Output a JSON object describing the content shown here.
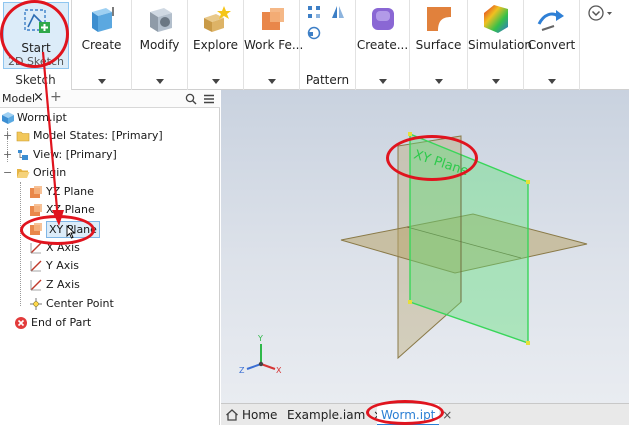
{
  "ribbon": {
    "sketch": {
      "start_label": "Start",
      "sketch2d_label": "2D Sketch",
      "group_title": "Sketch"
    },
    "buttons": {
      "create": "Create",
      "modify": "Modify",
      "explore": "Explore",
      "work_features": "Work Fe...",
      "pattern": "Pattern",
      "create_freeform": "Create...",
      "surface": "Surface",
      "simulation": "Simulation",
      "convert": "Convert"
    }
  },
  "browser": {
    "tab_label": "Model",
    "tab_close": "×",
    "tab_add": "+",
    "root": "Worm.ipt",
    "items": {
      "model_states": "Model States: [Primary]",
      "view": "View: [Primary]",
      "origin": "Origin",
      "yz_plane": "YZ Plane",
      "xz_plane": "XZ Plane",
      "xy_plane": "XY Plane",
      "x_axis": "X Axis",
      "y_axis": "Y Axis",
      "z_axis": "Z Axis",
      "center_point": "Center Point",
      "end_of_part": "End of Part"
    }
  },
  "viewport": {
    "plane_label": "XY Plane",
    "triad": {
      "x": "X",
      "y": "Y",
      "z": "Z"
    }
  },
  "doc_tabs": {
    "home": "Home",
    "example": "Example.iam",
    "worm": "Worm.ipt",
    "close": "×"
  },
  "colors": {
    "annotation": "#e0141e",
    "selected_plane": "#5fe07a",
    "plane_fill": "#b8a46a",
    "plane_label": "#2ec94c"
  }
}
